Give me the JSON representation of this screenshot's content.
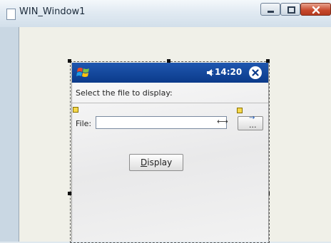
{
  "window": {
    "title": "WIN_Window1",
    "controls": {
      "minimize": "",
      "maximize": "",
      "close": ""
    }
  },
  "pda": {
    "status_time": "14:20",
    "labels": {
      "select_file": "Select the file to display:",
      "file": "File:",
      "browse": "...",
      "display_prefix": "D",
      "display_rest": "isplay"
    },
    "file_input": {
      "value": "",
      "placeholder": ""
    }
  },
  "icons": {
    "window": "document-icon",
    "start": "windows-flag-icon",
    "speaker": "speaker-icon",
    "ok": "close-circle-icon",
    "browse_arrow": "arrow-icon",
    "connector": "connector-arrow-icon"
  },
  "colors": {
    "titlebar": "#e1eaf2",
    "pda_bar": "#1f57b0",
    "close_button": "#c6472b",
    "client_bg": "#f0f0e8"
  }
}
